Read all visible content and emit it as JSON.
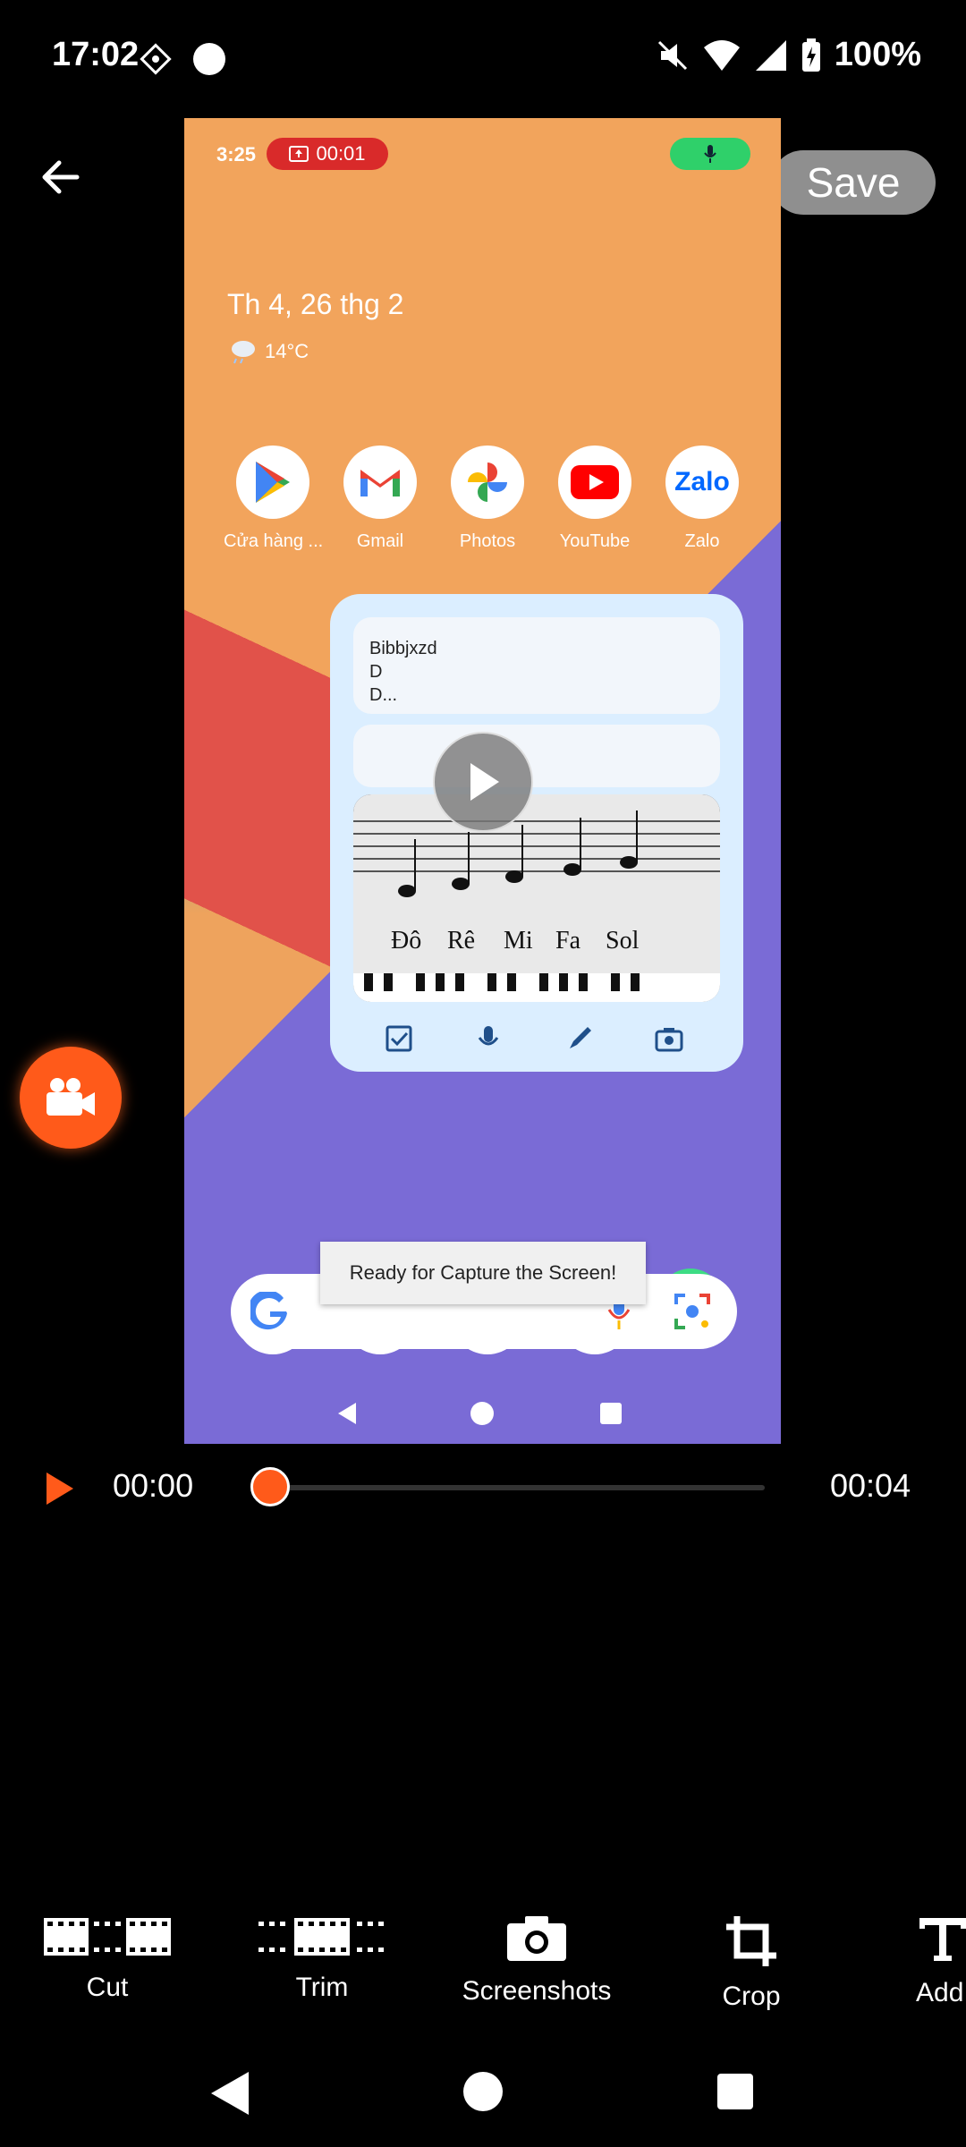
{
  "status_bar": {
    "time": "17:02",
    "battery": "100%"
  },
  "header": {
    "save_label": "Save"
  },
  "preview": {
    "time": "3:25",
    "rec_time": "00:01",
    "date": "Th 4, 26 thg 2",
    "temperature": "14°C",
    "apps": [
      {
        "label": "Cửa hàng ...",
        "icon": "play-store-icon"
      },
      {
        "label": "Gmail",
        "icon": "gmail-icon"
      },
      {
        "label": "Photos",
        "icon": "photos-icon"
      },
      {
        "label": "YouTube",
        "icon": "youtube-icon"
      },
      {
        "label": "Zalo",
        "icon": "zalo-icon"
      }
    ],
    "zalo_text": "Zalo",
    "note": {
      "line1": "Bibbjxzd",
      "line2": "D",
      "line3": "D..."
    },
    "notes_image_labels": [
      "Đô",
      "Rê",
      "Mi",
      "Fa",
      "Sol"
    ],
    "toast": "Ready for Capture the Screen!"
  },
  "timeline": {
    "current": "00:00",
    "total": "00:04",
    "progress": 0
  },
  "tools": [
    {
      "label": "Cut",
      "icon": "film-cut-icon"
    },
    {
      "label": "Trim",
      "icon": "film-trim-icon"
    },
    {
      "label": "Screenshots",
      "icon": "camera-icon"
    },
    {
      "label": "Crop",
      "icon": "crop-icon"
    },
    {
      "label": "Add",
      "icon": "text-icon"
    }
  ],
  "colors": {
    "accent": "#ff5a1a",
    "save_bg": "#8f8f8f"
  }
}
